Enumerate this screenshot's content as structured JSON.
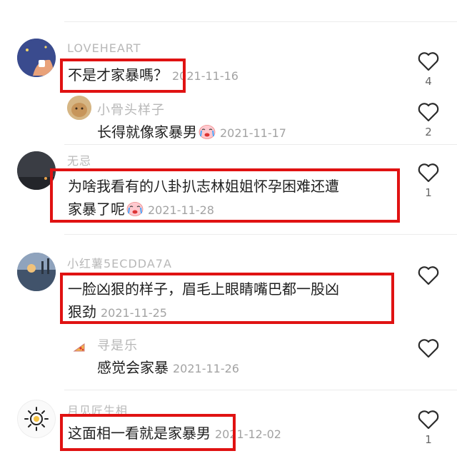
{
  "accent": "#e01212",
  "comments": [
    {
      "username": "LOVEHEART",
      "text": "不是才家暴嗎？",
      "time": "2021-11-16",
      "likes": "4"
    },
    {
      "username": "小骨头样子",
      "text": "长得就像家暴男",
      "time": "2021-11-17",
      "likes": "2",
      "emoji": "crying-face-emoji"
    },
    {
      "username": "无忌",
      "text_line1": "为啥我看有的八卦扒志林姐姐怀孕困难还遭",
      "text_line2": "家暴了呢",
      "time": "2021-11-28",
      "likes": "1",
      "emoji": "crying-face-emoji"
    },
    {
      "username": "小红薯5ECDDA7A",
      "text_line1": "一脸凶狠的样子，眉毛上眼睛嘴巴都一股凶",
      "text_line2": "狠劲",
      "time": "2021-11-25",
      "likes": ""
    },
    {
      "username": "寻是乐",
      "text": "感觉会家暴",
      "time": "2021-11-26",
      "likes": ""
    },
    {
      "username": "月见匠生相",
      "text": "这面相一看就是家暴男",
      "time": "2021-12-02",
      "likes": "1"
    }
  ]
}
